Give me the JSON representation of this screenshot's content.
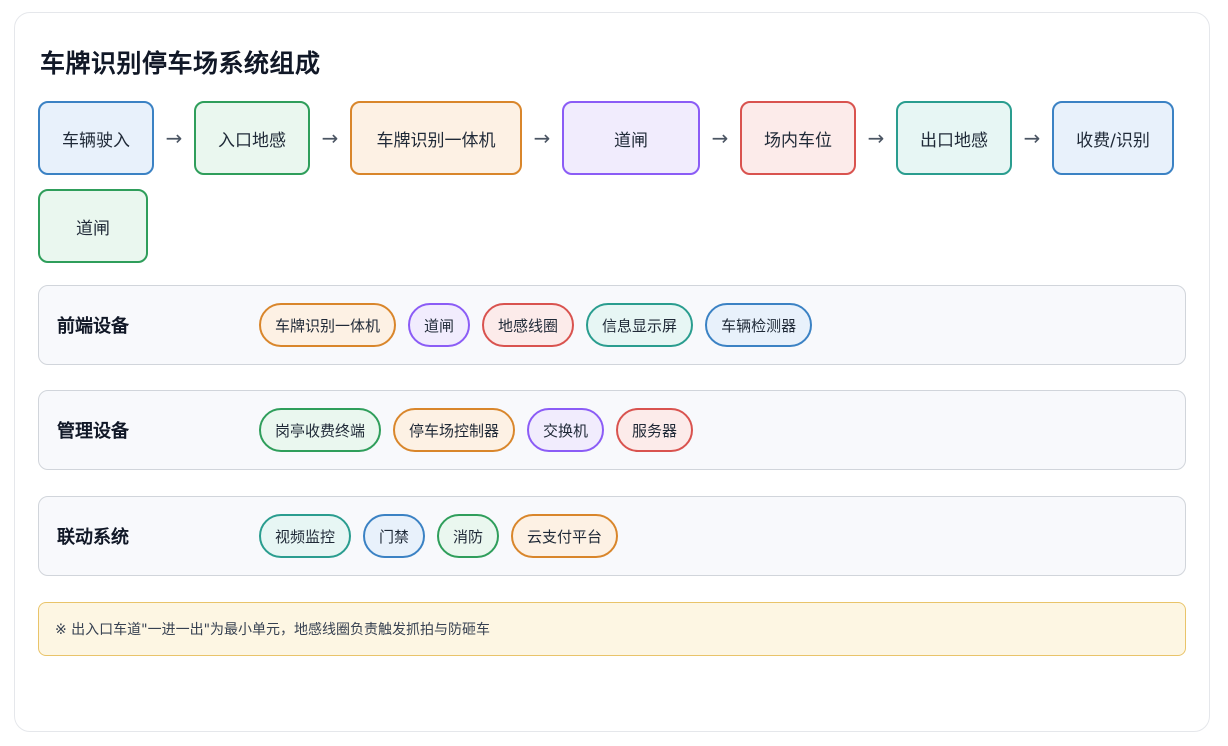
{
  "title": "车牌识别停车场系统组成",
  "flow": [
    {
      "label": "车辆驶入",
      "border": "#3b82c4",
      "fill": "#e8f1fb",
      "width": 116
    },
    {
      "label": "入口地感",
      "border": "#2f9e5b",
      "fill": "#eaf7ef",
      "width": 116
    },
    {
      "label": "车牌识别一体机",
      "border": "#d9862b",
      "fill": "#fdf1e4",
      "width": 172
    },
    {
      "label": "道闸",
      "border": "#8b5cf6",
      "fill": "#f1ecfd",
      "width": 138
    },
    {
      "label": "场内车位",
      "border": "#d9534f",
      "fill": "#fcebea",
      "width": 116
    },
    {
      "label": "出口地感",
      "border": "#2a9d8f",
      "fill": "#e7f6f4",
      "width": 116
    },
    {
      "label": "收费/识别",
      "border": "#3b82c4",
      "fill": "#e8f1fb",
      "width": 122
    },
    {
      "label": "道闸",
      "border": "#2f9e5b",
      "fill": "#eaf7ef",
      "width": 110
    }
  ],
  "arrow_glyph": "→",
  "panels": [
    {
      "label": "前端设备",
      "items": [
        {
          "label": "车牌识别一体机",
          "border": "#d9862b",
          "fill": "#fdf1e4"
        },
        {
          "label": "道闸",
          "border": "#8b5cf6",
          "fill": "#f1ecfd"
        },
        {
          "label": "地感线圈",
          "border": "#d9534f",
          "fill": "#fcebea"
        },
        {
          "label": "信息显示屏",
          "border": "#2a9d8f",
          "fill": "#e7f6f4"
        },
        {
          "label": "车辆检测器",
          "border": "#3b82c4",
          "fill": "#e8f1fb"
        }
      ]
    },
    {
      "label": "管理设备",
      "items": [
        {
          "label": "岗亭收费终端",
          "border": "#2f9e5b",
          "fill": "#eaf7ef"
        },
        {
          "label": "停车场控制器",
          "border": "#d9862b",
          "fill": "#fdf1e4"
        },
        {
          "label": "交换机",
          "border": "#8b5cf6",
          "fill": "#f1ecfd"
        },
        {
          "label": "服务器",
          "border": "#d9534f",
          "fill": "#fcebea"
        }
      ]
    },
    {
      "label": "联动系统",
      "items": [
        {
          "label": "视频监控",
          "border": "#2a9d8f",
          "fill": "#e7f6f4"
        },
        {
          "label": "门禁",
          "border": "#3b82c4",
          "fill": "#e8f1fb"
        },
        {
          "label": "消防",
          "border": "#2f9e5b",
          "fill": "#eaf7ef"
        },
        {
          "label": "云支付平台",
          "border": "#d9862b",
          "fill": "#fdf1e4"
        }
      ]
    }
  ],
  "note": "※ 出入口车道\"一进一出\"为最小单元，地感线圈负责触发抓拍与防砸车"
}
